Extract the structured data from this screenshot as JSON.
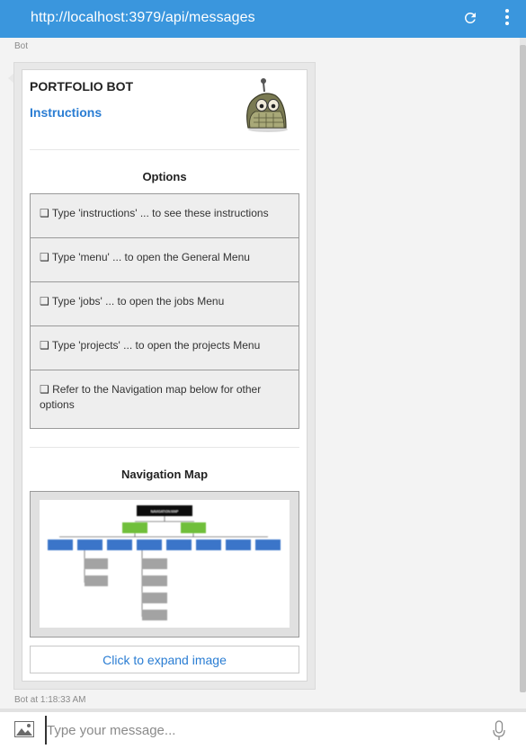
{
  "header": {
    "url": "http://localhost:3979/api/messages",
    "icons": {
      "refresh": "refresh-icon",
      "menu": "more-vert-icon"
    }
  },
  "message": {
    "sender": "Bot",
    "timestamp": "Bot at 1:18:33 AM",
    "card": {
      "title": "PORTFOLIO BOT",
      "subtitle": "Instructions",
      "options_heading": "Options",
      "options": [
        "❑ Type 'instructions' ... to see these instructions",
        "❑ Type 'menu' ... to open the General Menu",
        "❑ Type 'jobs' ... to open the jobs Menu",
        "❑ Type 'projects' ... to open the projects Menu",
        "❑ Refer to the Navigation map below for other options"
      ],
      "map_heading": "Navigation Map",
      "map_image_label": "NAVIGATION MAP",
      "expand_button": "Click to expand image"
    }
  },
  "composer": {
    "placeholder": "Type your message...",
    "icons": {
      "upload": "image-upload-icon",
      "mic": "microphone-icon"
    }
  },
  "colors": {
    "header": "#3a96dd",
    "link": "#2a7dd3",
    "option_bg": "#eeeeee"
  }
}
